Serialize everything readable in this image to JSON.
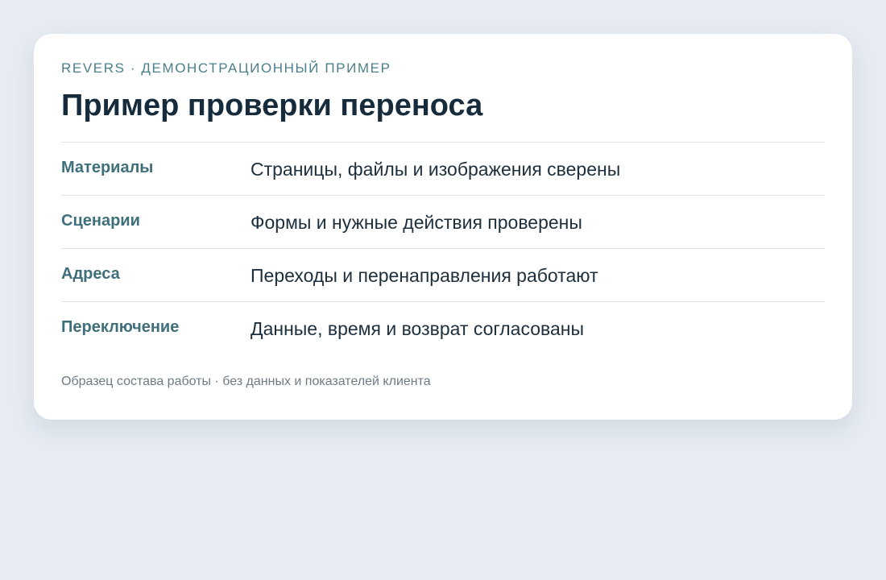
{
  "card": {
    "eyebrow": "REVERS · ДЕМОНСТРАЦИОННЫЙ ПРИМЕР",
    "title": "Пример проверки переноса",
    "rows": [
      {
        "label": "Материалы",
        "value": "Страницы, файлы и изображения сверены"
      },
      {
        "label": "Сценарии",
        "value": "Формы и нужные действия проверены"
      },
      {
        "label": "Адреса",
        "value": "Переходы и перенаправления работают"
      },
      {
        "label": "Переключение",
        "value": "Данные, время и возврат согласованы"
      }
    ],
    "footnote": "Образец состава работы · без данных и показателей клиента"
  },
  "colors": {
    "background": "#e7ecf3",
    "card": "#ffffff",
    "accent": "#3e6f7a",
    "title": "#162c3c",
    "divider": "#dfe4ea",
    "muted": "#6e7b86"
  }
}
